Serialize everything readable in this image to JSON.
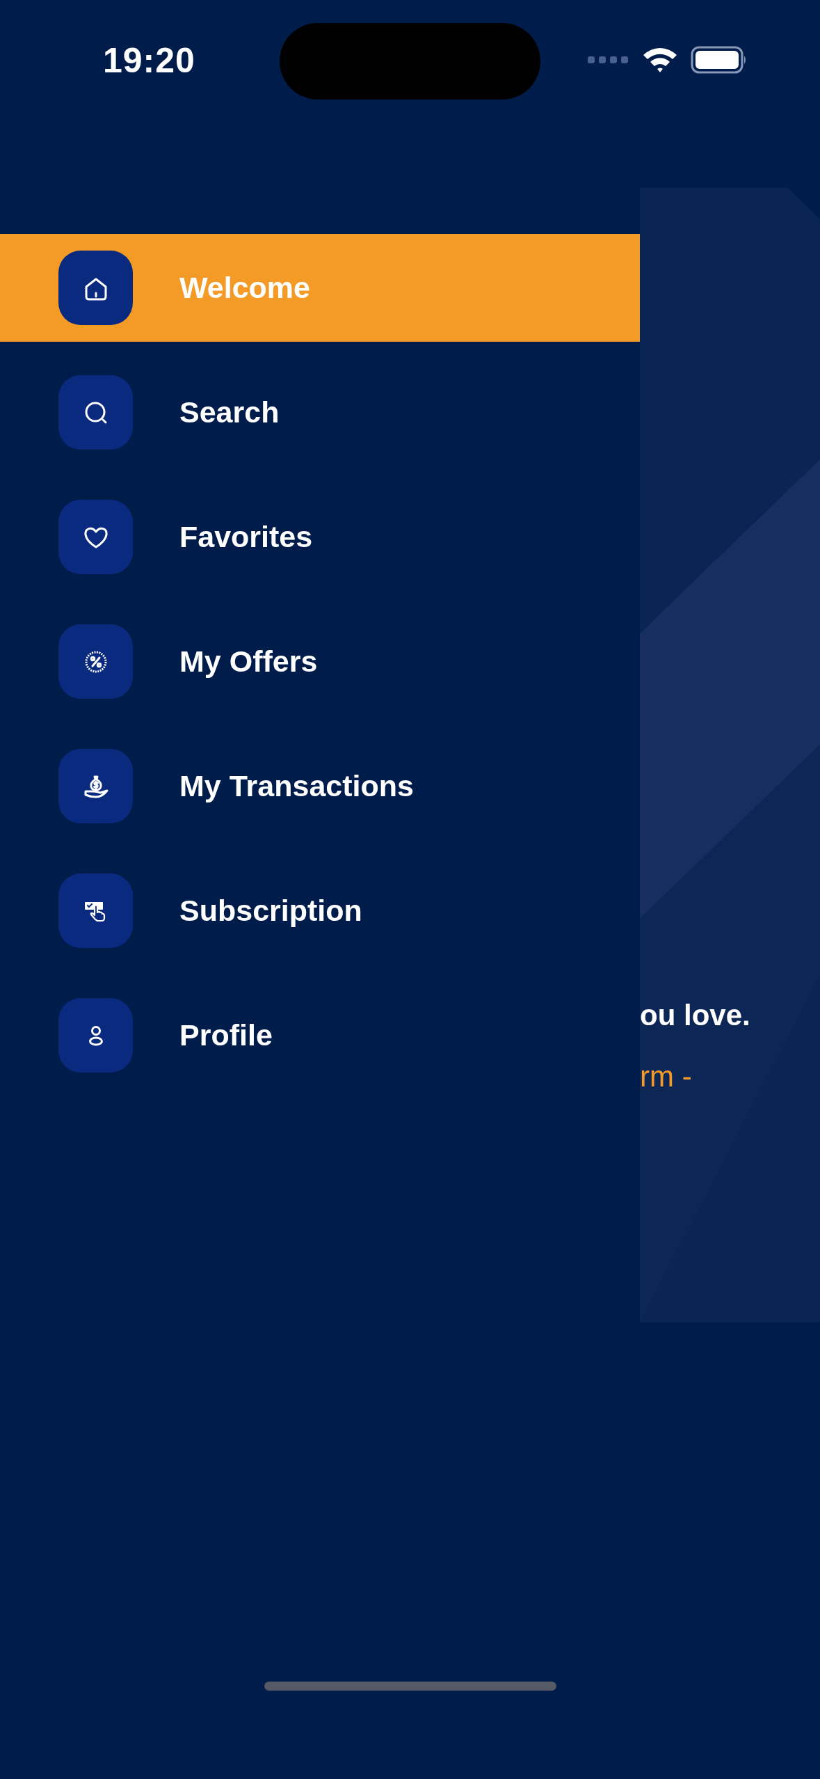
{
  "status_bar": {
    "time": "19:20"
  },
  "menu": {
    "items": [
      {
        "label": "Welcome",
        "selected": true
      },
      {
        "label": "Search",
        "selected": false
      },
      {
        "label": "Favorites",
        "selected": false
      },
      {
        "label": "My Offers",
        "selected": false
      },
      {
        "label": "My Transactions",
        "selected": false
      },
      {
        "label": "Subscription",
        "selected": false
      },
      {
        "label": "Profile",
        "selected": false
      }
    ]
  },
  "background_content": {
    "lines": [
      {
        "text": "ou love.",
        "kind": "heading"
      },
      {
        "text": "rm -",
        "kind": "accent"
      }
    ]
  }
}
